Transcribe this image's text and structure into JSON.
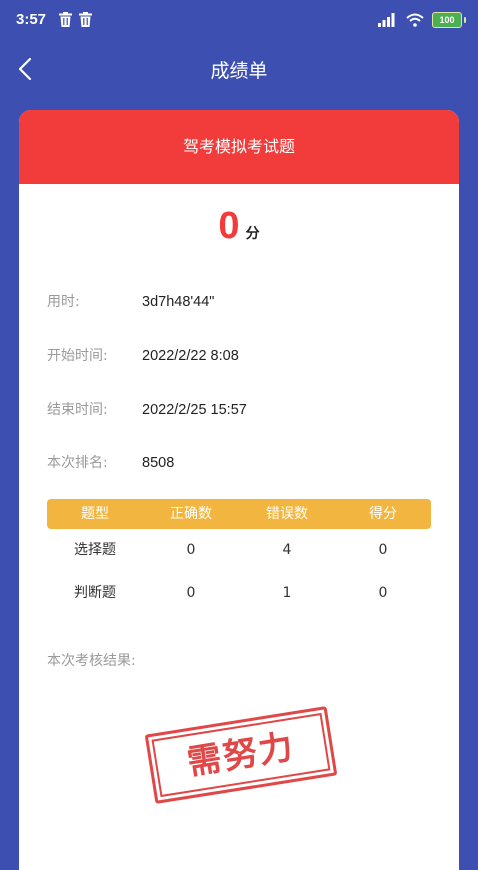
{
  "status_bar": {
    "time": "3:57",
    "battery": "100"
  },
  "nav": {
    "title": "成绩单"
  },
  "exam": {
    "title": "驾考模拟考试题"
  },
  "score": {
    "value": "0",
    "unit": "分"
  },
  "info": [
    {
      "label": "用时:",
      "value": "3d7h48'44\""
    },
    {
      "label": "开始时间:",
      "value": "2022/2/22 8:08"
    },
    {
      "label": "结束时间:",
      "value": "2022/2/25 15:57"
    },
    {
      "label": "本次排名:",
      "value": "8508"
    }
  ],
  "table": {
    "headers": [
      "题型",
      "正确数",
      "错误数",
      "得分"
    ],
    "rows": [
      [
        "选择题",
        "0",
        "4",
        "0"
      ],
      [
        "判断题",
        "0",
        "1",
        "0"
      ]
    ]
  },
  "result": {
    "label": "本次考核结果:",
    "stamp": "需努力"
  },
  "colors": {
    "background": "#3d4fb0",
    "header_red": "#f23c3c",
    "table_head": "#f2b640"
  }
}
